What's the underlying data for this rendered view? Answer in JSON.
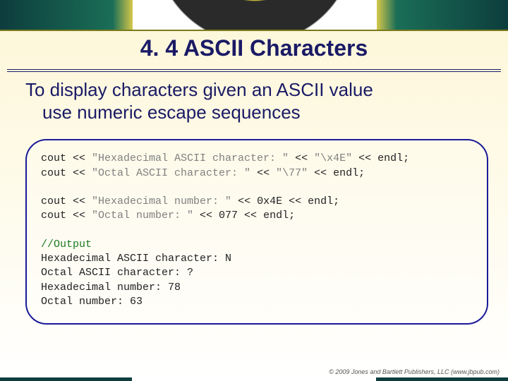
{
  "title": "4. 4 ASCII Characters",
  "intro": {
    "line1": "To display characters given an ASCII value",
    "line2": "use numeric escape sequences"
  },
  "code": {
    "l1a": "cout << ",
    "l1b": "\"Hexadecimal ASCII character: \"",
    "l1c": " << ",
    "l1d": "\"\\x4E\"",
    "l1e": " << endl;",
    "l2a": "cout << ",
    "l2b": "\"Octal ASCII character: \"",
    "l2c": " << ",
    "l2d": "\"\\77\"",
    "l2e": " << endl;",
    "l3a": "cout << ",
    "l3b": "\"Hexadecimal number: \"",
    "l3c": " << 0x4E << endl;",
    "l4a": "cout << ",
    "l4b": "\"Octal number: \"",
    "l4c": " << 077 << endl;",
    "cmt": "//Output",
    "o1": "Hexadecimal ASCII character: N",
    "o2": "Octal ASCII character: ?",
    "o3": "Hexadecimal number: 78",
    "o4": "Octal number: 63"
  },
  "footer": "© 2009 Jones and Bartlett Publishers, LLC (www.jbpub.com)"
}
